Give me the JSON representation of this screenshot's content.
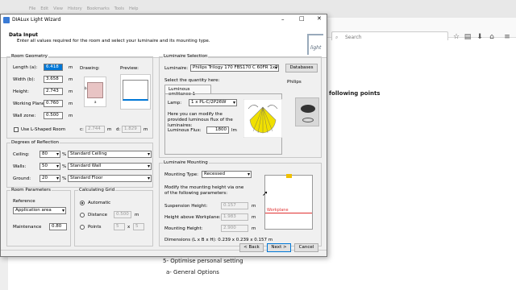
{
  "browser": {
    "menu": [
      "File",
      "Edit",
      "View",
      "History",
      "Bookmarks",
      "Tools",
      "Help"
    ],
    "search_placeholder": "Search",
    "page_lines": [
      "following points",
      "5- Optimise personal setting",
      "a- General Options"
    ]
  },
  "dialog": {
    "title": "DIALux Light Wizard",
    "header_title": "Data Input",
    "header_subtitle": "Enter all values required for the room and select your luminaire and its mounting type.",
    "logo_text": "light",
    "room_geometry": {
      "title": "Room Geometry",
      "fields": [
        {
          "label": "Length (a):",
          "value": "6.418",
          "unit": "m"
        },
        {
          "label": "Width (b):",
          "value": "3.658",
          "unit": "m"
        },
        {
          "label": "Height:",
          "value": "2.743",
          "unit": "m"
        },
        {
          "label": "Working Plane:",
          "value": "0.760",
          "unit": "m"
        },
        {
          "label": "Wall zone:",
          "value": "0.500",
          "unit": "m"
        }
      ],
      "drawing_label": "Drawing:",
      "preview_label": "Preview:",
      "l_shaped_label": "Use L-Shaped Room",
      "c_label": "c:",
      "c_value": "2.744",
      "c_unit": "m",
      "d_label": "d:",
      "d_value": "1.829",
      "d_unit": "m",
      "dim_a": "a",
      "dim_b": "b"
    },
    "reflection": {
      "title": "Degrees of Reflection",
      "rows": [
        {
          "label": "Ceiling:",
          "value": "80",
          "pct": "%",
          "option": "Standard Ceiling"
        },
        {
          "label": "Walls:",
          "value": "50",
          "pct": "%",
          "option": "Standard Wall"
        },
        {
          "label": "Ground:",
          "value": "20",
          "pct": "%",
          "option": "Standard Floor"
        }
      ]
    },
    "room_params": {
      "title": "Room Parameters",
      "reference_label": "Reference",
      "reference_value": "Application area",
      "maintenance_label": "Maintenance",
      "maintenance_value": "0.80"
    },
    "calc_grid": {
      "title": "Calculating Grid",
      "automatic": "Automatic",
      "distance": "Distance",
      "distance_value": "0.500",
      "distance_unit": "m",
      "points": "Points",
      "points_x": "5",
      "points_sep": "x",
      "points_y": "5"
    },
    "luminaire": {
      "title": "Luminaire Selection",
      "luminaire_label": "Luminaire:",
      "luminaire_value": "Philips  Trilogy 170 FBS170 C 60FR 1xPL-C/2...",
      "databases_btn": "Databases",
      "quantity_label": "Select the quantity here:",
      "tab_label": "Luminous emittance 1",
      "lamp_label": "Lamp:",
      "lamp_value": "1 x PL-C/2P26W",
      "modify_text": "Here you can modify the provided luminous flux of the luminaires:",
      "flux_label": "Luminous Flux:",
      "flux_value": "1800",
      "flux_unit": "lm",
      "brand": "Philips"
    },
    "mounting": {
      "title": "Luminaire Mounting",
      "type_label": "Mounting Type:",
      "type_value": "Recessed",
      "modify_text": "Modify the mounting height via one of the following parameters:",
      "rows": [
        {
          "label": "Suspension Height:",
          "value": "0.157",
          "unit": "m"
        },
        {
          "label": "Height above Workplane:",
          "value": "1.983",
          "unit": "m"
        },
        {
          "label": "Mounting Height:",
          "value": "2.900",
          "unit": "m"
        }
      ],
      "dimensions": "Dimensions (L x B x H): 0.239 x 0.239 x 0.157 m",
      "workplane_label": "Workplane"
    },
    "buttons": {
      "back": "< Back",
      "next": "Next >",
      "cancel": "Cancel"
    },
    "colors": {
      "accent": "#0078d7",
      "workplane": "#e03030",
      "polar": "#f0e000"
    }
  }
}
